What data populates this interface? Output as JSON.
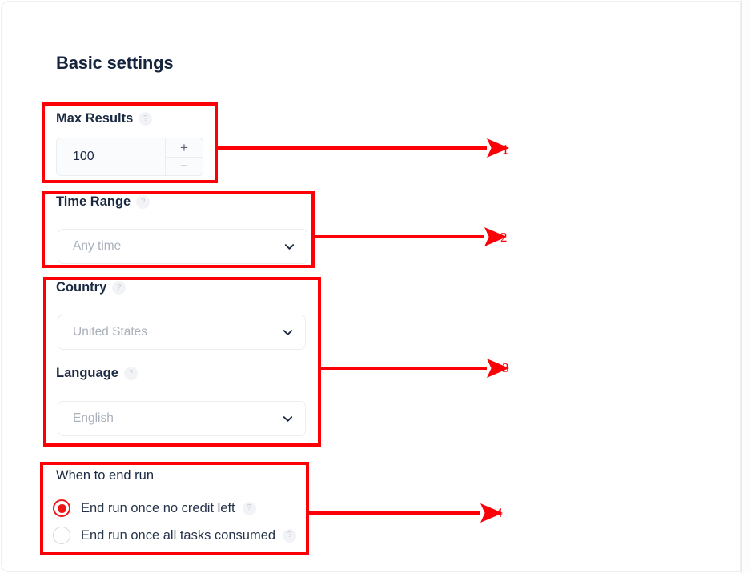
{
  "page": {
    "title": "Basic settings",
    "accent_red": "#fb0007",
    "text_navy": "#16253d",
    "help_icon_glyph": "?",
    "help_icon_name": "help-circle-icon"
  },
  "fields": {
    "max_results": {
      "label": "Max Results",
      "value": "100",
      "increment_label": "+",
      "decrement_label": "−"
    },
    "time_range": {
      "label": "Time Range",
      "value": "Any time",
      "placeholder": "Any time"
    },
    "country": {
      "label": "Country",
      "value": "United States",
      "placeholder": "United States"
    },
    "language": {
      "label": "Language",
      "value": "English",
      "placeholder": "English"
    },
    "end_run": {
      "label": "When to end run",
      "options": [
        {
          "label": "End run once no credit left",
          "selected": true
        },
        {
          "label": "End run once all tasks consumed",
          "selected": false
        }
      ]
    }
  },
  "annotations": {
    "color": "#fb0007",
    "items": [
      {
        "number": "1",
        "target": "max-results-field"
      },
      {
        "number": "2",
        "target": "time-range-field"
      },
      {
        "number": "3",
        "target": "country-language-fields"
      },
      {
        "number": "4",
        "target": "when-to-end-run-field"
      }
    ]
  }
}
